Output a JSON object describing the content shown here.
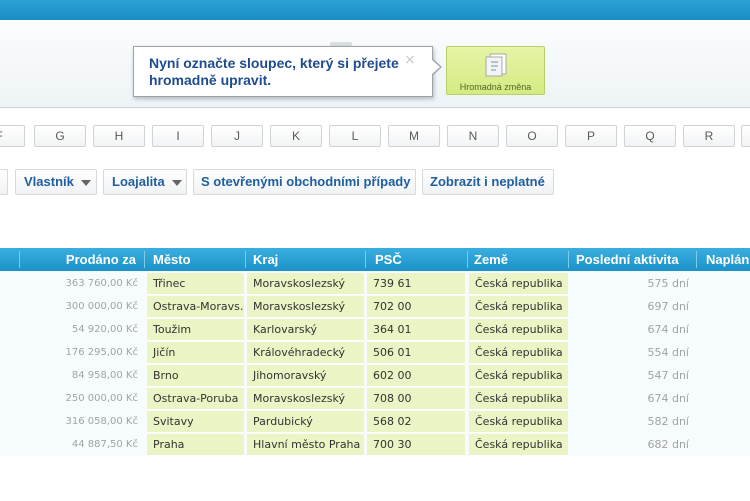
{
  "tooltip": {
    "text": "Nyní označte sloupec, který si přejete hromadně upravit.",
    "close": "×"
  },
  "toolbar": {
    "bulk_change_label": "Hromadná změna"
  },
  "letters": [
    "F",
    "G",
    "H",
    "I",
    "J",
    "K",
    "L",
    "M",
    "N",
    "O",
    "P",
    "Q",
    "R"
  ],
  "filters": {
    "owner": "Vlastník",
    "loyalty": "Loajalita",
    "open_deals": "S otevřenými obchodními případy",
    "show_invalid": "Zobrazit i neplatné"
  },
  "grid": {
    "headers": {
      "sold_for": "Prodáno za",
      "city": "Město",
      "region": "Kraj",
      "zip": "PSČ",
      "country": "Země",
      "last_activity": "Poslední aktivita",
      "planned": "Naplán"
    },
    "rows": [
      {
        "sold": "363 760,00 Kč",
        "city": "Třinec",
        "region": "Moravskoslezský",
        "zip": "739 61",
        "country": "Česká republika",
        "activity": "575 dní"
      },
      {
        "sold": "300 000,00 Kč",
        "city": "Ostrava-Moravs…",
        "region": "Moravskoslezský",
        "zip": "702 00",
        "country": "Česká republika",
        "activity": "697 dní"
      },
      {
        "sold": "54 920,00 Kč",
        "city": "Toužim",
        "region": "Karlovarský",
        "zip": "364 01",
        "country": "Česká republika",
        "activity": "674 dní"
      },
      {
        "sold": "176 295,00 Kč",
        "city": "Jičín",
        "region": "Královéhradecký",
        "zip": "506 01",
        "country": "Česká republika",
        "activity": "554 dní"
      },
      {
        "sold": "84 958,00 Kč",
        "city": "Brno",
        "region": "Jihomoravský",
        "zip": "602 00",
        "country": "Česká republika",
        "activity": "547 dní"
      },
      {
        "sold": "250 000,00 Kč",
        "city": "Ostrava-Poruba",
        "region": "Moravskoslezský",
        "zip": "708 00",
        "country": "Česká republika",
        "activity": "674 dní"
      },
      {
        "sold": "316 058,00 Kč",
        "city": "Svitavy",
        "region": "Pardubický",
        "zip": "568 02",
        "country": "Česká republika",
        "activity": "582 dní"
      },
      {
        "sold": "44 887,50 Kč",
        "city": "Praha",
        "region": "Hlavní město Praha",
        "zip": "700 30",
        "country": "Česká republika",
        "activity": "682 dní"
      }
    ]
  }
}
